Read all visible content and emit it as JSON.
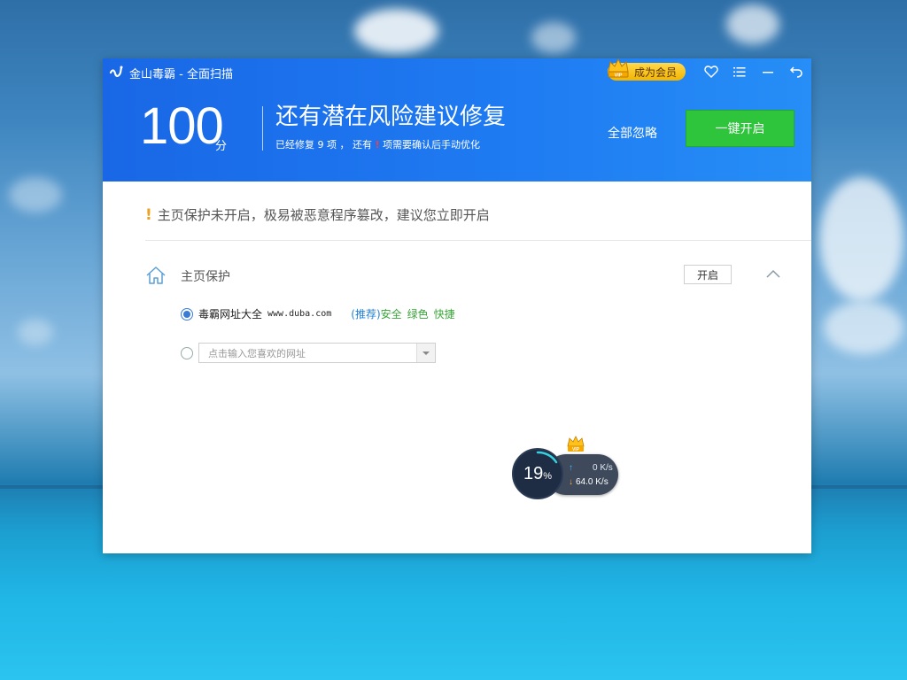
{
  "window": {
    "title": "金山毒霸 - 全面扫描",
    "vip_label": "成为会员"
  },
  "header": {
    "score": "100",
    "score_unit": "分",
    "headline": "还有潜在风险建议修复",
    "sub_prefix": "已经修复 9 项 ， 还有",
    "sub_mark": "!",
    "sub_suffix": "项需要确认后手动优化",
    "ignore_all": "全部忽略",
    "one_click": "一键开启"
  },
  "warning": {
    "icon": "!",
    "text": "主页保护未开启，极易被恶意程序篡改，建议您立即开启"
  },
  "section": {
    "title": "主页保护",
    "enable_label": "开启",
    "options": [
      {
        "label": "毒霸网址大全",
        "url": "www.duba.com",
        "recommend": "(推荐)",
        "tags": [
          "安全",
          "绿色",
          "快捷"
        ],
        "selected": true
      },
      {
        "placeholder": "点击输入您喜欢的网址",
        "selected": false
      }
    ]
  },
  "speed": {
    "percent": "19",
    "percent_unit": "%",
    "upload": "0 K/s",
    "download": "64.0 K/s"
  },
  "colors": {
    "header_blue": "#1f7cf2",
    "button_green": "#2ec43c",
    "vip_gold": "#f2b400",
    "warning_orange": "#f0a020"
  }
}
